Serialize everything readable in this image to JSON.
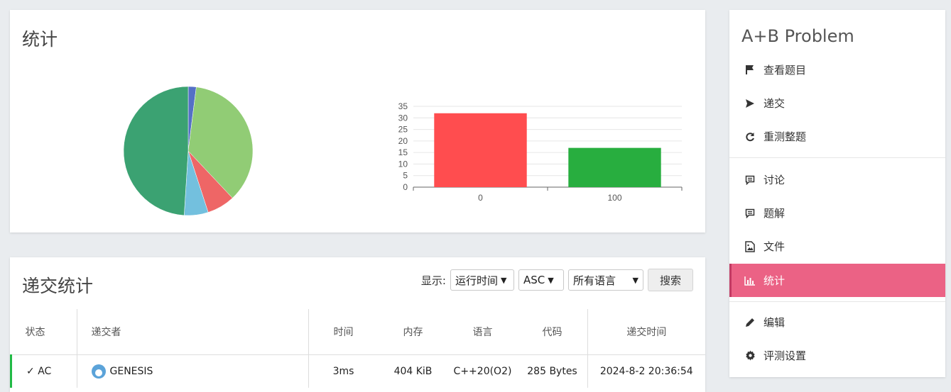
{
  "stats": {
    "title": "统计"
  },
  "chart_data": [
    {
      "type": "pie",
      "slices": [
        {
          "value": 2,
          "color": "#5470c6"
        },
        {
          "value": 36,
          "color": "#91cc75"
        },
        {
          "value": 7,
          "color": "#ee6666"
        },
        {
          "value": 6,
          "color": "#73c0de"
        },
        {
          "value": 49,
          "color": "#3ba272"
        }
      ]
    },
    {
      "type": "bar",
      "categories": [
        "0",
        "100"
      ],
      "values": [
        32,
        17
      ],
      "colors": [
        "#ff4d4f",
        "#28ae3f"
      ],
      "ylim": [
        0,
        35
      ],
      "yticks": [
        "0",
        "5",
        "10",
        "15",
        "20",
        "25",
        "30",
        "35"
      ],
      "grid": true
    }
  ],
  "submissions": {
    "title": "递交统计",
    "filter_label": "显示:",
    "sort_field": "运行时间",
    "sort_order": "ASC",
    "language": "所有语言",
    "search_label": "搜索",
    "columns": [
      "状态",
      "递交者",
      "时间",
      "内存",
      "语言",
      "代码",
      "递交时间"
    ],
    "rows": [
      {
        "status": "AC",
        "user": "GENESIS",
        "time": "3ms",
        "memory": "404 KiB",
        "language": "C++20(O2)",
        "code": "285 Bytes",
        "submitted": "2024-8-2 20:36:54"
      }
    ]
  },
  "sidebar": {
    "problem_title": "A+B Problem",
    "items": [
      {
        "label": "查看题目",
        "icon": "flag-icon"
      },
      {
        "label": "递交",
        "icon": "send-icon"
      },
      {
        "label": "重测整题",
        "icon": "refresh-icon"
      },
      {
        "label": "讨论",
        "icon": "comment-icon"
      },
      {
        "label": "题解",
        "icon": "comment-icon"
      },
      {
        "label": "文件",
        "icon": "image-file-icon"
      },
      {
        "label": "统计",
        "icon": "bar-chart-icon"
      },
      {
        "label": "编辑",
        "icon": "pencil-icon"
      },
      {
        "label": "评测设置",
        "icon": "gear-icon"
      }
    ],
    "accent": "#eb6285"
  }
}
